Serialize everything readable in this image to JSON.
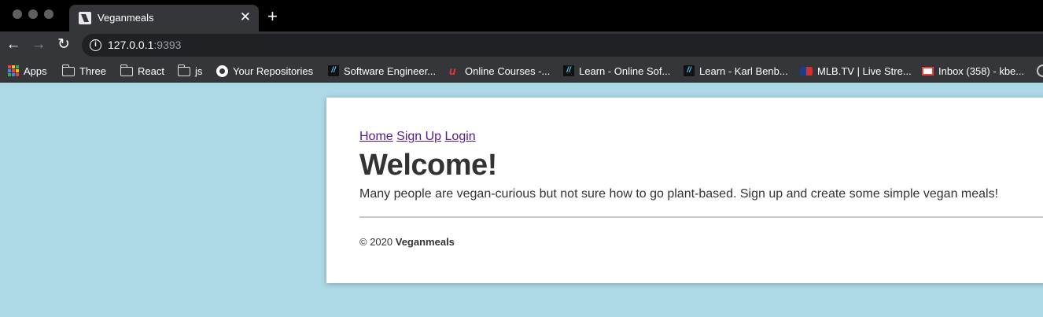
{
  "browser": {
    "tab": {
      "title": "Veganmeals",
      "close_glyph": "✕"
    },
    "new_tab_glyph": "+",
    "nav": {
      "back": "←",
      "forward": "→",
      "reload": "↻"
    },
    "address": {
      "host": "127.0.0.1",
      "port": ":9393"
    },
    "bookmarks": [
      {
        "label": "Apps",
        "icon": "apps-grid-icon"
      },
      {
        "label": "Three",
        "icon": "folder-icon"
      },
      {
        "label": "React",
        "icon": "folder-icon"
      },
      {
        "label": "js",
        "icon": "folder-icon"
      },
      {
        "label": "Your Repositories",
        "icon": "github-icon"
      },
      {
        "label": "Software Engineer...",
        "icon": "learn-co-icon"
      },
      {
        "label": "Online Courses -...",
        "icon": "udemy-icon"
      },
      {
        "label": "Learn - Online Sof...",
        "icon": "learn-co-icon"
      },
      {
        "label": "Learn - Karl Benb...",
        "icon": "learn-co-icon"
      },
      {
        "label": "MLB.TV | Live Stre...",
        "icon": "mlb-icon"
      },
      {
        "label": "Inbox (358) - kbe...",
        "icon": "gmail-icon"
      }
    ]
  },
  "site": {
    "nav": {
      "home": "Home",
      "signup": "Sign Up",
      "login": "Login"
    },
    "heading": "Welcome!",
    "intro": "Many people are vegan-curious but not sure how to go plant-based. Sign up and create some simple vegan meals!",
    "footer": {
      "copyright": "© 2020",
      "brand": "Veganmeals"
    }
  },
  "colors": {
    "page_background": "#add8e6",
    "link_visited": "#551a8b",
    "text": "#333333"
  }
}
